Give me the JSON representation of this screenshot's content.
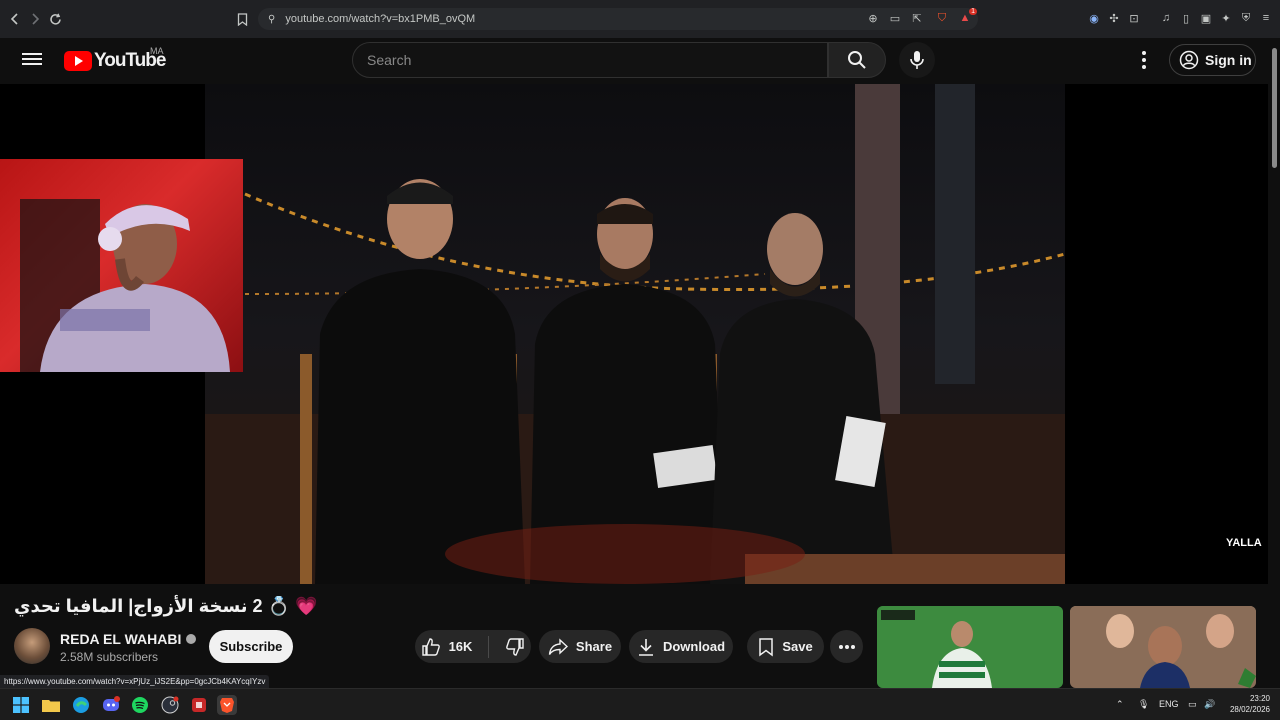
{
  "browser": {
    "url": "youtube.com/watch?v=bx1PMB_ovQM",
    "extension_badge": "1"
  },
  "youtube": {
    "logo_text": "YouTube",
    "country_code": "MA",
    "search_placeholder": "Search",
    "sign_in_label": "Sign in"
  },
  "video": {
    "title": "💗 💍 2 نسخة الأزواج| المافيا تحدي",
    "watermark": "YALLA",
    "channel_name": "REDA EL WAHABI",
    "subscribers": "2.58M subscribers",
    "subscribe_label": "Subscribe",
    "like_count": "16K",
    "share_label": "Share",
    "download_label": "Download",
    "save_label": "Save"
  },
  "status_bar": {
    "hover_url": "https://www.youtube.com/watch?v=xPjUz_iJS2E&pp=0gcJCb4KAYcqIYzv"
  },
  "taskbar": {
    "language": "ENG",
    "time": "23:20",
    "date": "28/02/2026"
  },
  "colors": {
    "youtube_red": "#ff0000",
    "background": "#0f0f0f",
    "pill": "#272727"
  }
}
